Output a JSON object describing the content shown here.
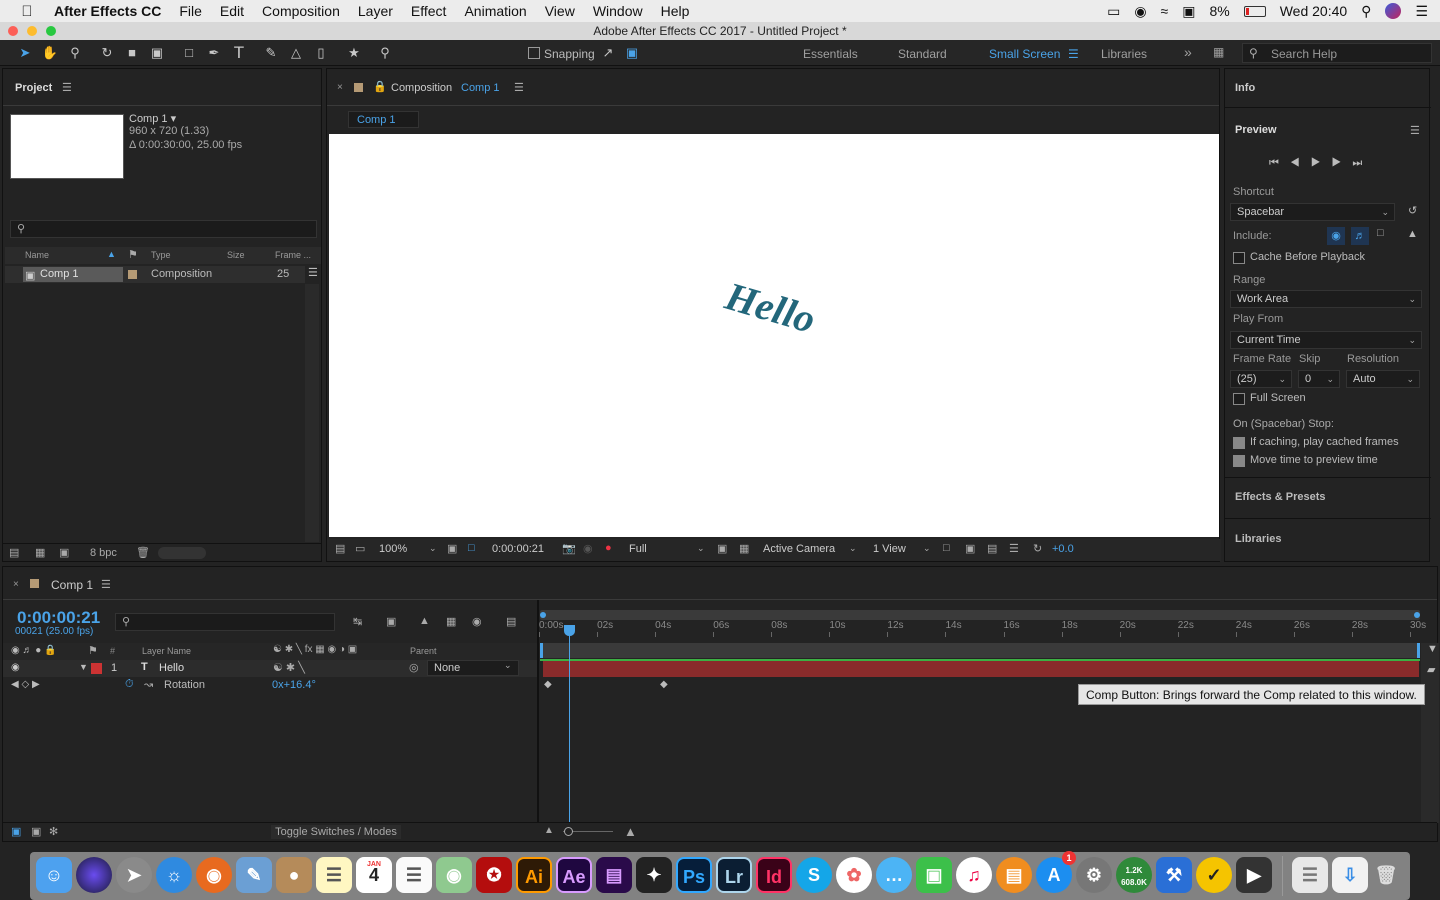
{
  "menubar": {
    "apple": "",
    "app": "After Effects CC",
    "items": [
      "File",
      "Edit",
      "Composition",
      "Layer",
      "Effect",
      "Animation",
      "View",
      "Window",
      "Help"
    ],
    "battery": "8%",
    "clock": "Wed 20:40"
  },
  "window": {
    "title": "Adobe After Effects CC 2017 - Untitled Project *"
  },
  "toolbar": {
    "snapping": "Snapping",
    "workspaces": [
      "Essentials",
      "Standard",
      "Small Screen",
      "Libraries"
    ],
    "active_workspace": "Small Screen",
    "search_placeholder": "Search Help"
  },
  "project": {
    "title": "Project",
    "comp_name": "Comp 1 ▾",
    "comp_size": "960 x 720 (1.33)",
    "comp_dur": "Δ 0:00:30:00, 25.00 fps",
    "columns": [
      "Name",
      "Type",
      "Size",
      "Frame ..."
    ],
    "rows": [
      {
        "name": "Comp 1",
        "type": "Composition",
        "size": "",
        "frame": "25"
      }
    ],
    "bpc": "8 bpc"
  },
  "composition": {
    "panel_label": "Composition",
    "comp_link": "Comp 1",
    "tab": "Comp 1",
    "text": "Hello",
    "zoom": "100%",
    "timecode": "0:00:00:21",
    "resolution": "Full",
    "camera": "Active Camera",
    "views": "1 View",
    "exposure": "+0.0"
  },
  "right": {
    "info": "Info",
    "preview": "Preview",
    "shortcut_label": "Shortcut",
    "shortcut": "Spacebar",
    "include_label": "Include:",
    "cache_before": "Cache Before Playback",
    "range_label": "Range",
    "range": "Work Area",
    "play_from_label": "Play From",
    "play_from": "Current Time",
    "frame_rate_label": "Frame Rate",
    "skip_label": "Skip",
    "resolution_label": "Resolution",
    "frame_rate": "(25)",
    "skip": "0",
    "res": "Auto",
    "full_screen": "Full Screen",
    "stop_label": "On (Spacebar) Stop:",
    "if_caching": "If caching, play cached frames",
    "move_time": "Move time to preview time",
    "effects": "Effects & Presets",
    "libraries": "Libraries"
  },
  "timeline": {
    "tab": "Comp 1",
    "timecode": "0:00:00:21",
    "frames": "00021 (25.00 fps)",
    "col_hash": "#",
    "col_layer": "Layer Name",
    "col_parent": "Parent",
    "layer_num": "1",
    "layer_type": "T",
    "layer_name": "Hello",
    "parent": "None",
    "prop": "Rotation",
    "prop_value": "0x+16.4°",
    "toggle": "Toggle Switches / Modes",
    "ticks": [
      "0:00s",
      "02s",
      "04s",
      "06s",
      "08s",
      "10s",
      "12s",
      "14s",
      "16s",
      "18s",
      "20s",
      "22s",
      "24s",
      "26s",
      "28s",
      "30s"
    ],
    "tooltip": "Comp Button: Brings forward the Comp related to this window."
  },
  "dock": {
    "apps": [
      "Finder",
      "Siri",
      "Launchpad",
      "Safari",
      "Firefox",
      "Preview",
      "Contacts",
      "Notes",
      "Calendar",
      "Reminders",
      "Maps",
      "Acrobat",
      "Ai",
      "Ae",
      "Premiere",
      "Ink",
      "Ps",
      "Lr",
      "Id",
      "Skype",
      "Photos",
      "Messages",
      "FaceTime",
      "iTunes",
      "iBooks",
      "App Store",
      "System Prefs",
      "Monitor",
      "Xcode",
      "Norton",
      "Terminal"
    ],
    "calendar_month": "JAN",
    "calendar_day": "4",
    "appstore_badge": "1",
    "monitor_top": "1.2K",
    "monitor_bottom": "608.0K"
  }
}
